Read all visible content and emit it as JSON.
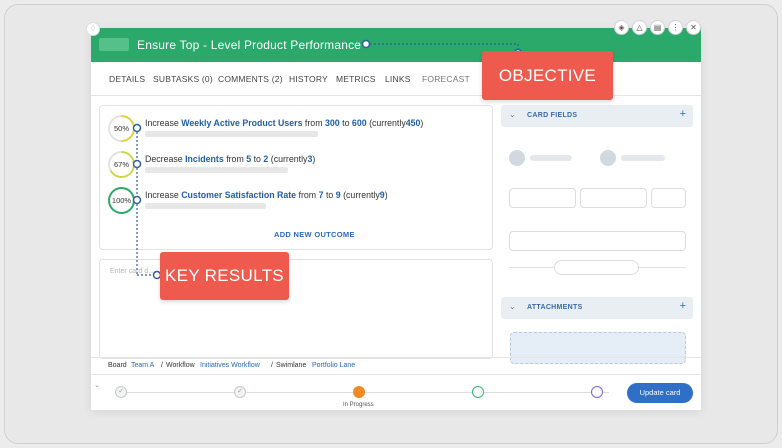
{
  "card": {
    "title": "Ensure Top - Level Product Performance",
    "header_color": "#2aa96a"
  },
  "tabs": [
    {
      "label": "DETAILS"
    },
    {
      "label": "SUBTASKS (0)"
    },
    {
      "label": "COMMENTS (2)"
    },
    {
      "label": "HISTORY"
    },
    {
      "label": "METRICS"
    },
    {
      "label": "LINKS"
    },
    {
      "label": "FORECAST"
    }
  ],
  "key_results": [
    {
      "percent": "50%",
      "progress": 0.5,
      "ring_color": "#e0d146",
      "verb": "Increase",
      "metric": "Weekly Active Product Users",
      "from_word": "from",
      "from": "300",
      "to_word": "to",
      "to": "600",
      "current_open": "(currently",
      "current": "450",
      "current_close": ")"
    },
    {
      "percent": "67%",
      "progress": 0.67,
      "ring_color": "#c9d84a",
      "verb": "Decrease",
      "metric": "Incidents",
      "from_word": "from",
      "from": "5",
      "to_word": "to",
      "to": "2",
      "current_open": "(currently",
      "current": "3",
      "current_close": ")"
    },
    {
      "percent": "100%",
      "progress": 1.0,
      "ring_color": "#2aa96a",
      "verb": "Increase",
      "metric": "Customer Satisfaction Rate",
      "from_word": "from",
      "from": "7",
      "to_word": "to",
      "to": "9",
      "current_open": "(currently",
      "current": "9",
      "current_close": ")"
    }
  ],
  "add_outcome_label": "ADD NEW OUTCOME",
  "description_placeholder": "Enter card d...",
  "sidebar": {
    "card_fields_title": "CARD FIELDS",
    "attachments_title": "ATTACHMENTS"
  },
  "breadcrumb": {
    "board_label": "Board",
    "board_value": "Team A",
    "sep1": "/",
    "workflow_label": "Workflow",
    "workflow_value": "Initiatives Workflow",
    "sep2": "/",
    "swimlane_label": "Swimlane",
    "swimlane_value": "Portfolio Lane"
  },
  "footer": {
    "active_step_label": "In Progress",
    "update_button": "Update card"
  },
  "callouts": {
    "objective": "OBJECTIVE",
    "key_results": "KEY RESULTS",
    "color": "#ef5a4f"
  }
}
